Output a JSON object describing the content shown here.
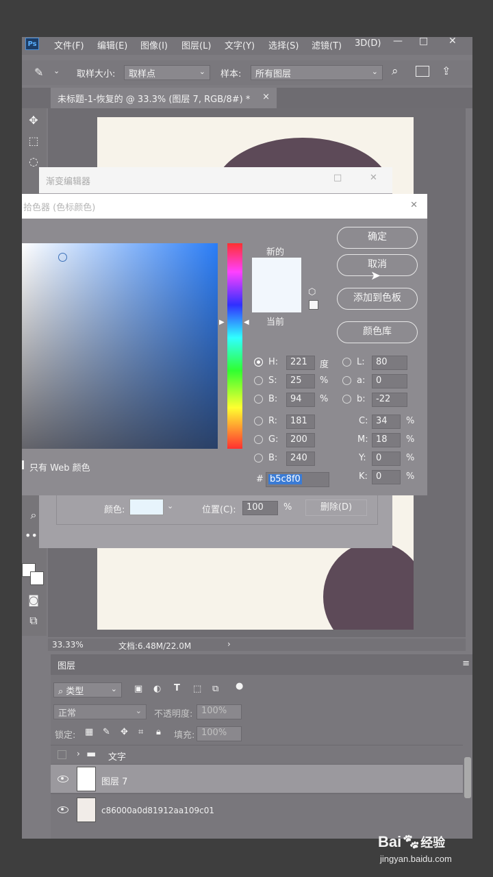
{
  "menu": [
    "文件(F)",
    "编辑(E)",
    "图像(I)",
    "图层(L)",
    "文字(Y)",
    "选择(S)",
    "滤镜(T)",
    "3D(D)"
  ],
  "app_logo": "Ps",
  "options": {
    "sample_size_label": "取样大小:",
    "sample_size_value": "取样点",
    "sample_label": "样本:",
    "sample_value": "所有图层"
  },
  "doc_tab": {
    "title": "未标题-1-恢复的 @ 33.3% (图层 7, RGB/8#) *",
    "close": "×"
  },
  "gradient_editor": {
    "title": "渐变编辑器",
    "color_label": "颜色:",
    "position_label": "位置(C):",
    "position_value": "100",
    "percent": "%",
    "delete_label": "删除(D)",
    "swatch_color": "#e7f4fc"
  },
  "color_picker": {
    "title": "拾色器 (色标颜色)",
    "new_label": "新的",
    "current_label": "当前",
    "ok": "确定",
    "cancel": "取消",
    "add_to_swatches": "添加到色板",
    "color_libraries": "颜色库",
    "web_only": "只有 Web 颜色",
    "hsb": {
      "h_label": "H:",
      "h": "221",
      "h_unit": "度",
      "s_label": "S:",
      "s": "25",
      "s_unit": "%",
      "b_label": "B:",
      "b": "94",
      "b_unit": "%"
    },
    "rgb": {
      "r_label": "R:",
      "r": "181",
      "g_label": "G:",
      "g": "200",
      "b_label": "B:",
      "b": "240"
    },
    "lab": {
      "l_label": "L:",
      "l": "80",
      "a_label": "a:",
      "a": "0",
      "b_label": "b:",
      "b": "-22"
    },
    "cmyk": {
      "c_label": "C:",
      "c": "34",
      "m_label": "M:",
      "m": "18",
      "y_label": "Y:",
      "y": "0",
      "k_label": "K:",
      "k": "0",
      "unit": "%"
    },
    "hex_label": "#",
    "hex": "b5c8f0",
    "new_color": "#f2f7fd",
    "current_color": "#f2f7fd"
  },
  "status": {
    "zoom": "33.33%",
    "doc": "文档:6.48M/22.0M",
    "arrow": "›"
  },
  "layers_panel": {
    "tab": "图层",
    "filter_type": "类型",
    "blend_mode": "正常",
    "opacity_label": "不透明度:",
    "opacity_value": "100%",
    "lock_label": "锁定:",
    "fill_label": "填充:",
    "fill_value": "100%",
    "layers": [
      {
        "name": "文字",
        "kind": "group"
      },
      {
        "name": "图层 7",
        "kind": "layer"
      },
      {
        "name": "c86000a0d81912aa109c01",
        "kind": "image"
      }
    ]
  },
  "watermark": {
    "brand": "Bai",
    "brand2": "经验",
    "url": "jingyan.baidu.com"
  }
}
